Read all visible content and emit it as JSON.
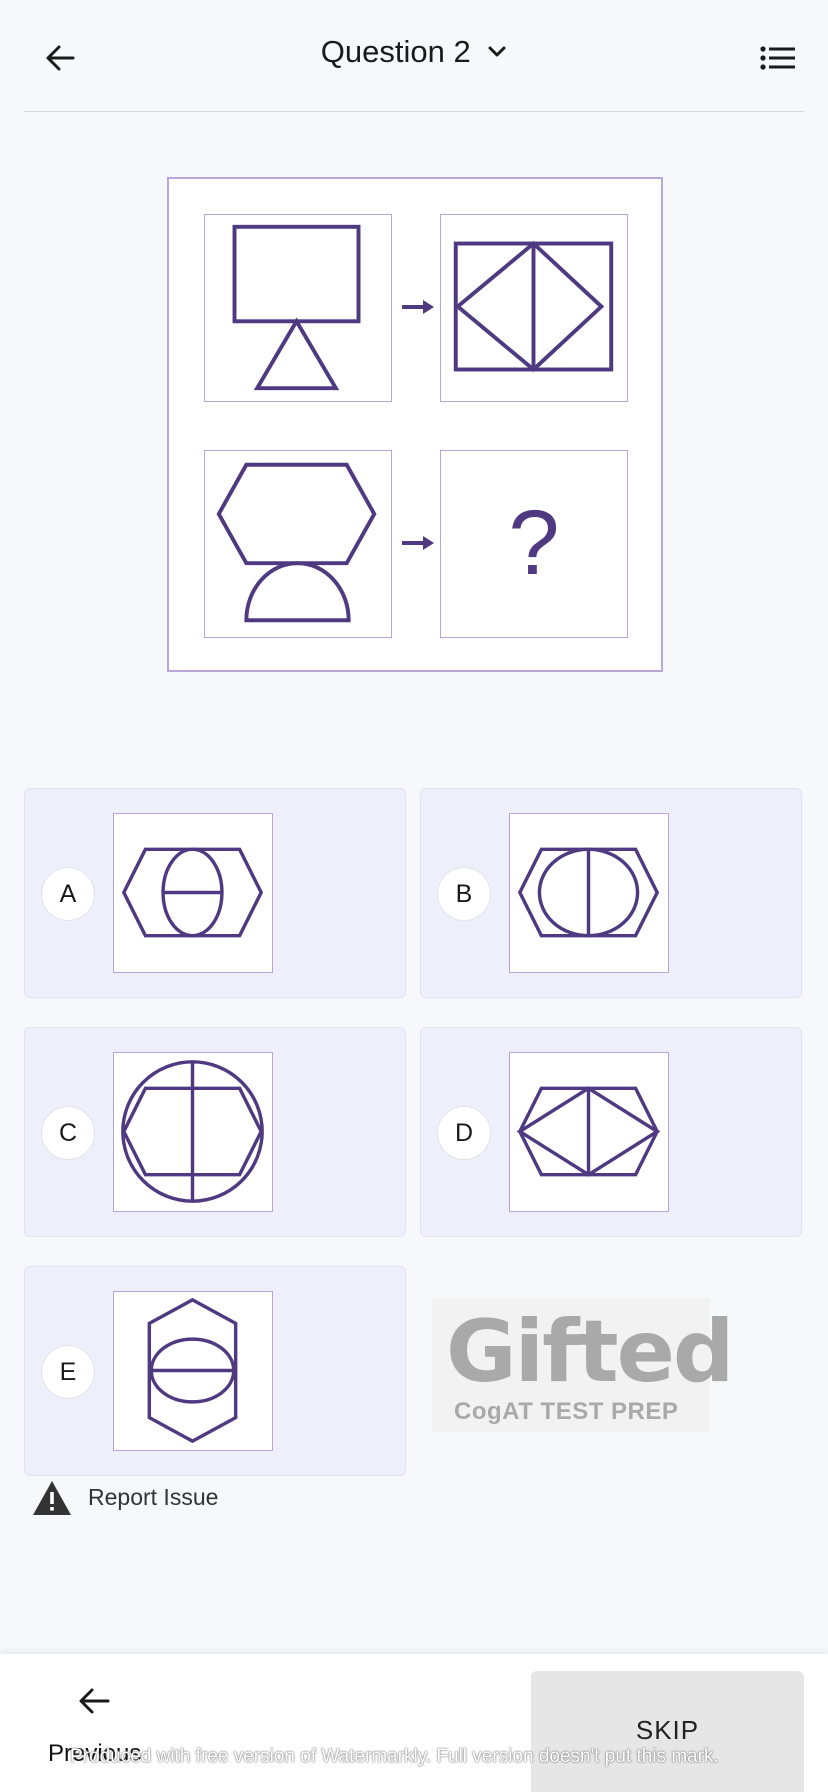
{
  "header": {
    "title": "Question 2"
  },
  "question": {
    "unknown_symbol": "?"
  },
  "options": [
    {
      "letter": "A"
    },
    {
      "letter": "B"
    },
    {
      "letter": "C"
    },
    {
      "letter": "D"
    },
    {
      "letter": "E"
    }
  ],
  "logo": {
    "brand": "Gifted",
    "tagline": "CogAT TEST PREP"
  },
  "report": {
    "label": "Report Issue"
  },
  "footer": {
    "previous_label": "Previous",
    "skip_label": "SKIP"
  },
  "watermark": {
    "text": "Produced with free version of Watermarkly. Full version doesn't put this mark."
  },
  "colors": {
    "shape_stroke": "#4f3a82",
    "cell_border": "#b9a6d8",
    "option_bg": "#edf0fb"
  },
  "icons": [
    "back-arrow-icon",
    "chevron-down-icon",
    "list-menu-icon",
    "warning-icon"
  ]
}
